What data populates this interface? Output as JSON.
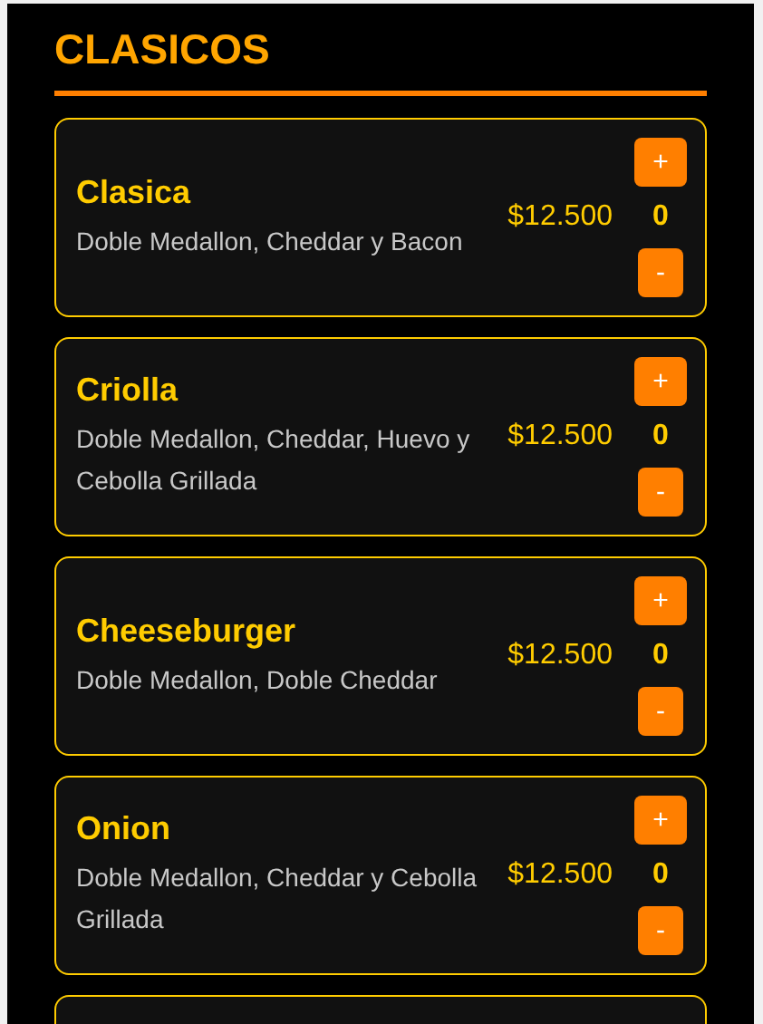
{
  "section": {
    "title": "CLASICOS"
  },
  "items": [
    {
      "name": "Clasica",
      "description": "Doble Medallon, Cheddar y Bacon",
      "price": "$12.500",
      "quantity": "0",
      "add": "+",
      "remove": "-"
    },
    {
      "name": "Criolla",
      "description": "Doble Medallon, Cheddar, Huevo y Cebolla Grillada",
      "price": "$12.500",
      "quantity": "0",
      "add": "+",
      "remove": "-"
    },
    {
      "name": "Cheeseburger",
      "description": "Doble Medallon, Doble Cheddar",
      "price": "$12.500",
      "quantity": "0",
      "add": "+",
      "remove": "-"
    },
    {
      "name": "Onion",
      "description": "Doble Medallon, Cheddar y Cebolla Grillada",
      "price": "$12.500",
      "quantity": "0",
      "add": "+",
      "remove": "-"
    }
  ]
}
